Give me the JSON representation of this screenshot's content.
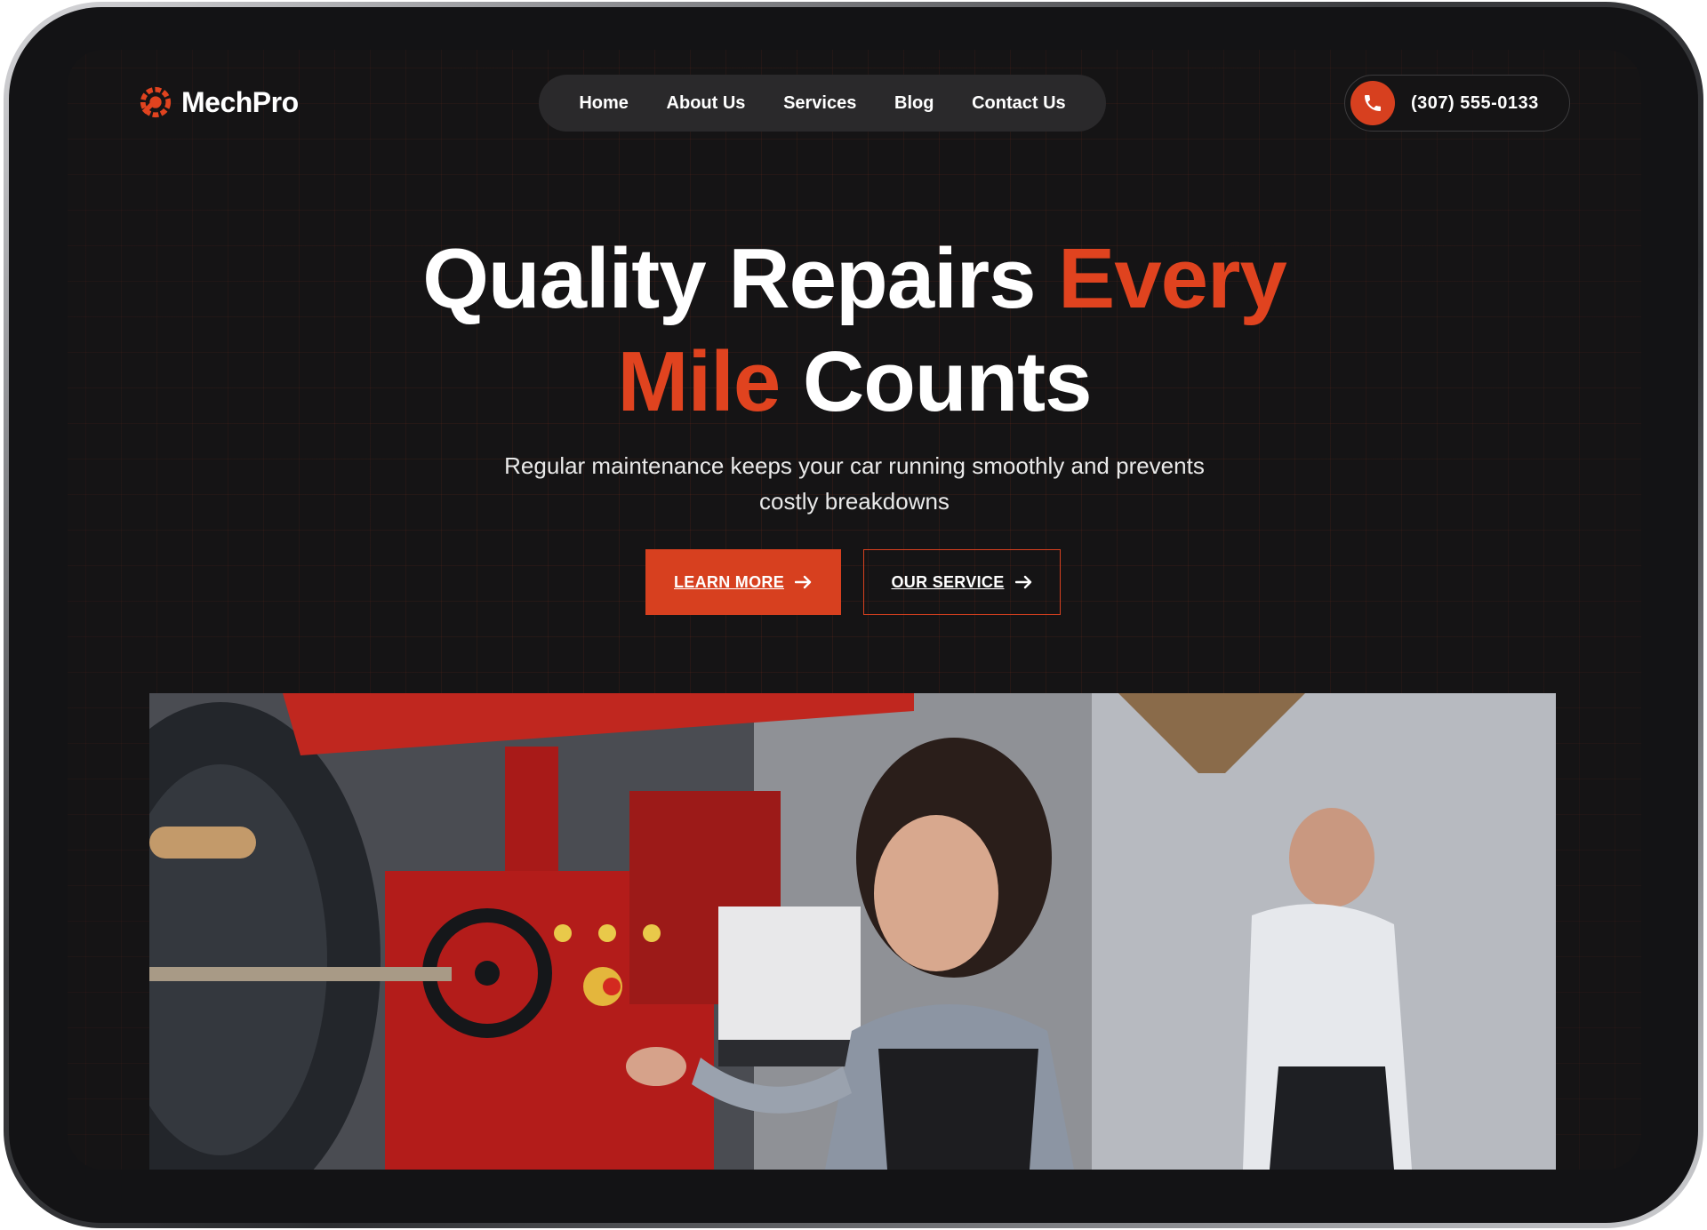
{
  "brand": {
    "name": "MechPro"
  },
  "nav": {
    "items": [
      {
        "label": "Home"
      },
      {
        "label": "About Us"
      },
      {
        "label": "Services"
      },
      {
        "label": "Blog"
      },
      {
        "label": "Contact Us"
      }
    ]
  },
  "contact": {
    "phone": "(307) 555-0133",
    "icon": "phone-icon"
  },
  "hero": {
    "title_line1_white": "Quality Repairs ",
    "title_line1_accent": "Every",
    "title_line2_accent": "Mile",
    "title_line2_white": " Counts",
    "subtitle": "Regular maintenance keeps your car running smoothly and prevents costly breakdowns",
    "primary_button": "LEARN MORE",
    "secondary_button": "OUR SERVICE"
  },
  "colors": {
    "accent": "#d7401f",
    "background": "#151415",
    "nav_pill": "#2a292b",
    "text": "#ffffff"
  }
}
